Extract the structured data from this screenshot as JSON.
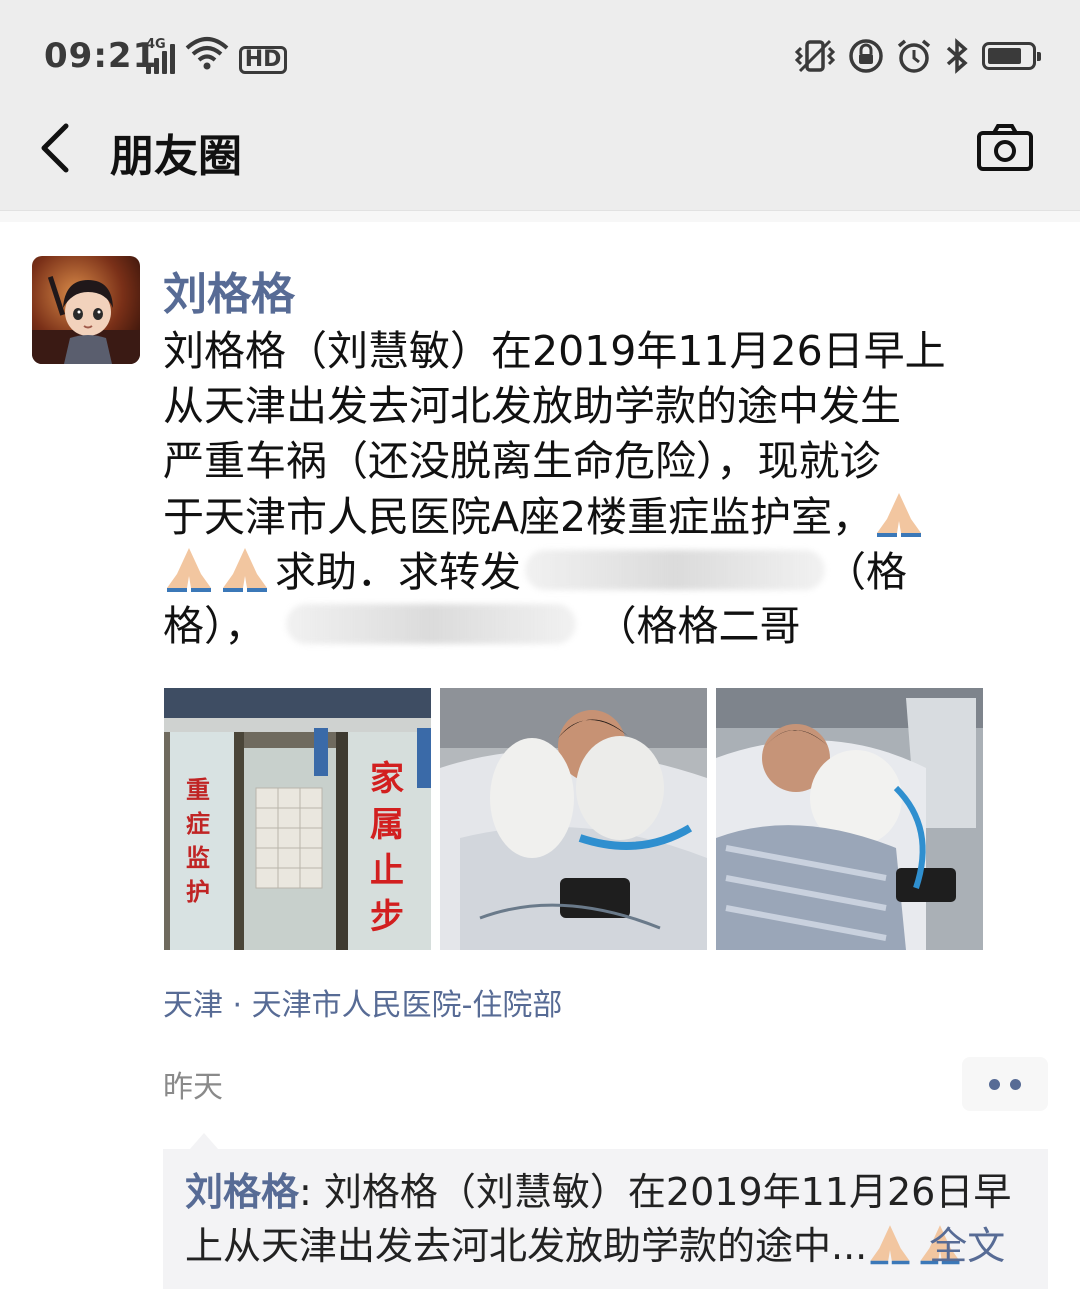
{
  "status_bar": {
    "time": "09:21",
    "network": "4G",
    "hd_badge": "HD",
    "icons": [
      "signal-icon",
      "wifi-icon",
      "hd-icon",
      "vibrate-icon",
      "rotation-lock-icon",
      "alarm-icon",
      "bluetooth-icon",
      "battery-icon"
    ]
  },
  "nav": {
    "title": "朋友圈",
    "back_icon": "chevron-left-icon",
    "camera_icon": "camera-icon"
  },
  "post": {
    "author": "刘格格",
    "text_lines": [
      "刘格格（刘慧敏）在2019年11月26日早上",
      "从天津出发去河北发放助学款的途中发生",
      "严重车祸（还没脱离生命危险），现就诊",
      "于天津市人民医院A座2楼重症监护室，"
    ],
    "text_line5_mid": "求助．求转发",
    "text_line5_end": "（格",
    "text_line6_start": "格），",
    "text_line6_end": "（格格二哥",
    "photos": [
      {
        "sign_vertical": "家属止步",
        "sign_side": "重症监护"
      },
      {
        "label": "patient-photo-2"
      },
      {
        "label": "patient-photo-3"
      }
    ],
    "location": "天津 · 天津市人民医院-住院部",
    "time": "昨天"
  },
  "share": {
    "author": "刘格格",
    "separator": ": ",
    "line1_text": "刘格格（刘慧敏）在2019年11月26日早",
    "line2_text": "上从天津出发去河北发放助学款的途中...",
    "full_text_link": "全文"
  },
  "colors": {
    "link_blue": "#576b95",
    "bar_gray": "#ededed",
    "share_bg": "#f3f3f5"
  }
}
